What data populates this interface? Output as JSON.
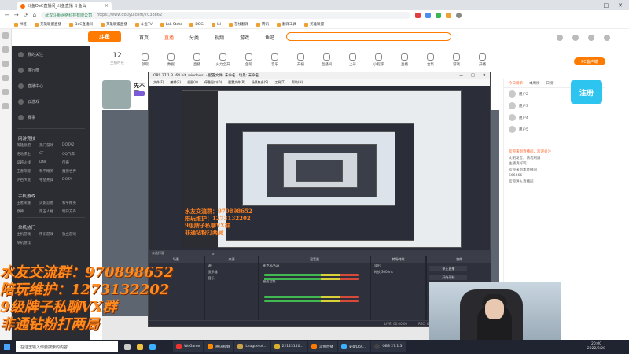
{
  "browser": {
    "tab_title": "斗鱼DoC直播间_斗鱼直播 斗鱼山",
    "url": "https://www.douyu.com/7038862",
    "url_prefix": "武汉斗鱼网络科技有限公司",
    "bookmarks": [
      "书签",
      "英雄联盟直播",
      "DoC直播间",
      "英雄联盟直播",
      "斗鱼TV",
      "LoL Stats",
      "DGG",
      "lol",
      "在线翻译",
      "腾讯",
      "翻译工具",
      "英雄联盟"
    ]
  },
  "douyu": {
    "logo": "斗鱼",
    "nav": [
      "首页",
      "直播",
      "分类",
      "视频",
      "游戏",
      "鱼吧"
    ],
    "sidebar": {
      "top_items": [
        "我的关注",
        "排行榜",
        "直播中心",
        "云游戏",
        "赛事"
      ],
      "section1": "网游竞技",
      "grid1": [
        "英雄联盟",
        "热门游戏",
        "DOTA2",
        "绝地求生",
        "CF",
        "QQ飞车",
        "穿越火线",
        "DNF",
        "传奇",
        "王者荣耀",
        "和平精英",
        "魔兽世界",
        "炉石传说",
        "守望先锋",
        "DOTA"
      ],
      "section2": "手机游戏",
      "grid2": [
        "王者荣耀",
        "火影忍者",
        "和平精英",
        "原神",
        "第五人格",
        "明日方舟"
      ],
      "section3": "单机热门",
      "grid3": [
        "主机游戏",
        "怀旧游戏",
        "独立游戏",
        "单机游戏"
      ]
    },
    "follow_count": "12",
    "follow_label": "主播时长",
    "categories": [
      "领取",
      "数据",
      "直播",
      "火力全开",
      "鱼吧",
      "音乐",
      "开播",
      "直播间",
      "上号",
      "小程序",
      "直播",
      "合集",
      "游戏",
      "开播"
    ],
    "pc_button": "PC客户端",
    "streamer_name": "先不要"
  },
  "obs": {
    "title": "OBS 27.1.3 (64 bit, windows) - 配置文件: 未命名 - 场景: 未命名",
    "menu": [
      "文件(F)",
      "编辑(E)",
      "视图(V)",
      "停靠窗口(D)",
      "配置文件(P)",
      "场景集合(S)",
      "工具(T)",
      "帮助(H)"
    ],
    "overlay_lines": [
      "水友交流群：970898652",
      "陪玩维护：1273132202",
      "9级牌子私聊VX群",
      "非通钻粉打两局"
    ],
    "scene_label": "未选择源",
    "docks": [
      "场景",
      "来源",
      "混音器",
      "转场特效",
      "控件"
    ],
    "sources": [
      "源",
      "显示器",
      "音乐"
    ],
    "mixer": [
      "麦克风/Aux",
      "桌面音频"
    ],
    "transitions": [
      "淡出",
      "时长 300 ms"
    ],
    "controls": [
      "停止直播",
      "开始录制",
      "工作室模式",
      "设置",
      "退出"
    ],
    "status": [
      "LIVE: 00:00:00",
      "REC: 00:00:00",
      "CPU: 3.0%, 60.00 fps"
    ]
  },
  "chat": {
    "tabs": [
      "今日榜单",
      "本周榜",
      "日榜"
    ],
    "users": [
      "用户2",
      "用户3",
      "用户4",
      "用户5"
    ],
    "messages": [
      "欢迎来到直播间，欢迎关注",
      "文明发言，请勿刷屏",
      "主播真好玩",
      "欢迎来到本直播间",
      "666666",
      "欢迎进入直播间"
    ],
    "banner": "注册"
  },
  "big_overlay": [
    "水友交流群：970898652",
    "陪玩维护：1273132202",
    "9级牌子私聊VX群",
    "非通钻粉打两局"
  ],
  "taskbar": {
    "search_placeholder": "在这里输入你要搜索的内容",
    "apps": [
      "WeGame",
      "腾讯视频",
      "League of...",
      "22123140...",
      "斗鱼直播",
      "安徽DoC...",
      "OBS 27.1.3"
    ],
    "time": "20:00",
    "date": "2022/2/28"
  }
}
